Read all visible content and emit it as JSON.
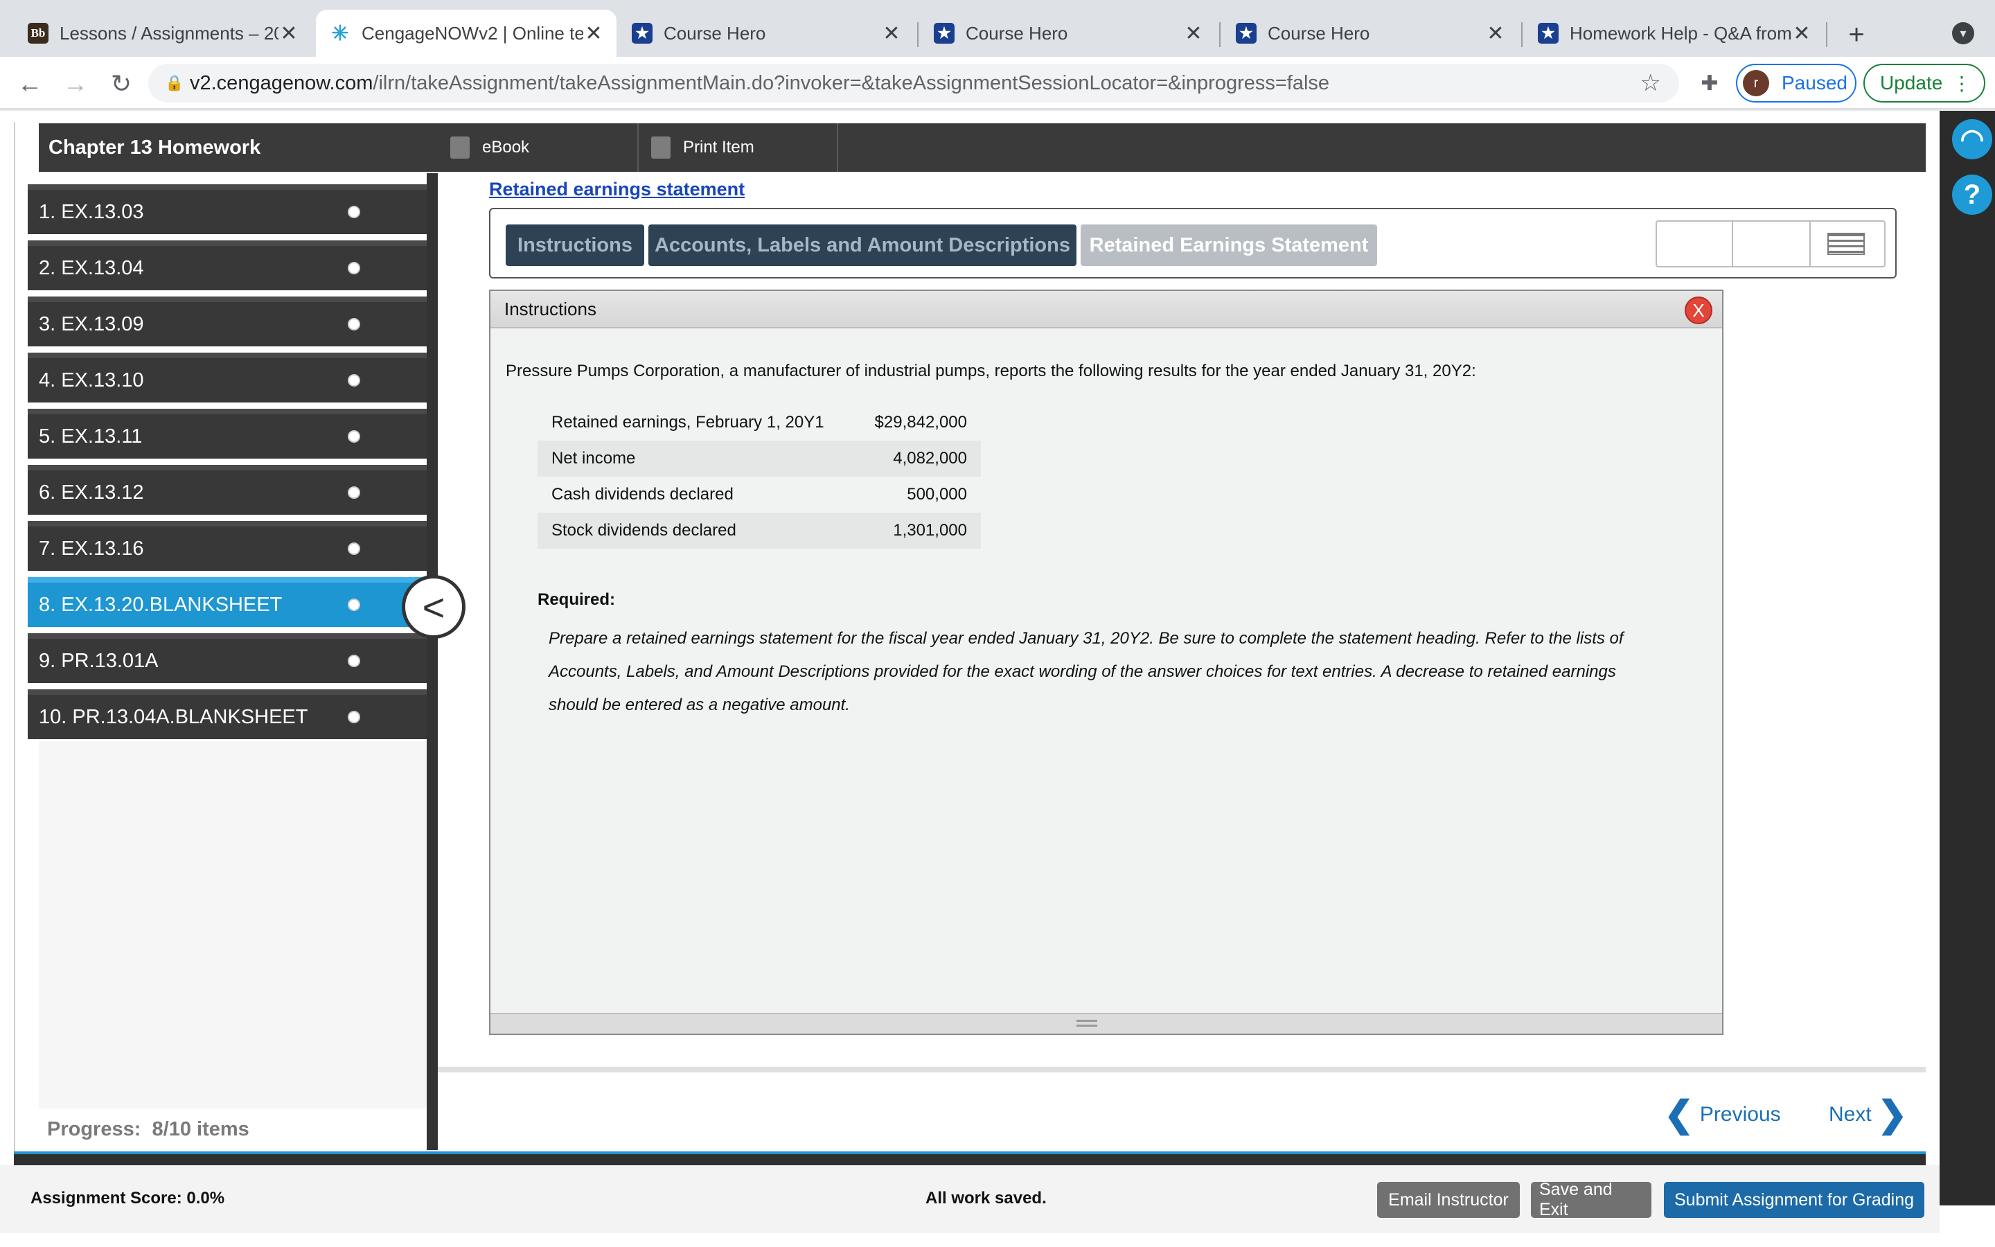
{
  "browser": {
    "tabs": [
      {
        "title": "Lessons / Assignments – 20",
        "favicon": "bb-favicon",
        "active": false
      },
      {
        "title": "CengageNOWv2 | Online te",
        "favicon": "cengage-favicon",
        "active": true
      },
      {
        "title": "Course Hero",
        "favicon": "coursehero-favicon",
        "active": false
      },
      {
        "title": "Course Hero",
        "favicon": "coursehero-favicon",
        "active": false
      },
      {
        "title": "Course Hero",
        "favicon": "coursehero-favicon",
        "active": false
      },
      {
        "title": "Homework Help - Q&A from",
        "favicon": "coursehero-favicon",
        "active": false
      }
    ],
    "url_host": "v2.cengagenow.com",
    "url_path": "/ilrn/takeAssignment/takeAssignmentMain.do?invoker=&takeAssignmentSessionLocator=&inprogress=false",
    "profile_initial": "r",
    "profile_label": "Paused",
    "update_label": "Update"
  },
  "assignment": {
    "title": "Chapter 13 Homework",
    "toolbar": {
      "ebook": "eBook",
      "print_item": "Print Item"
    },
    "questions": [
      {
        "label": "1. EX.13.03"
      },
      {
        "label": "2. EX.13.04"
      },
      {
        "label": "3. EX.13.09"
      },
      {
        "label": "4. EX.13.10"
      },
      {
        "label": "5. EX.13.11"
      },
      {
        "label": "6. EX.13.12"
      },
      {
        "label": "7. EX.13.16"
      },
      {
        "label": "8. EX.13.20.BLANKSHEET",
        "active": true
      },
      {
        "label": "9. PR.13.01A"
      },
      {
        "label": "10. PR.13.04A.BLANKSHEET"
      }
    ],
    "progress_label": "Progress:",
    "progress_value": "8/10 items",
    "progress_fraction": 0.8
  },
  "content": {
    "section_title": "Retained earnings statement",
    "subtabs": [
      "Instructions",
      "Accounts, Labels and Amount Descriptions",
      "Retained Earnings Statement"
    ],
    "selected_subtab": "Retained Earnings Statement",
    "panel_title": "Instructions",
    "close_label": "X",
    "intro": "Pressure Pumps Corporation, a manufacturer of industrial pumps, reports the following results for the year ended January 31, 20Y2:",
    "rows": [
      {
        "label": "Retained earnings, February 1, 20Y1",
        "amount": "$29,842,000"
      },
      {
        "label": "Net income",
        "amount": "4,082,000"
      },
      {
        "label": "Cash dividends declared",
        "amount": "500,000"
      },
      {
        "label": "Stock dividends declared",
        "amount": "1,301,000"
      }
    ],
    "required_label": "Required:",
    "required_text": "Prepare a retained earnings statement for the fiscal year ended January 31, 20Y2. Be sure to complete the statement heading. Refer to the lists of Accounts, Labels, and Amount Descriptions provided for the exact wording of the answer choices for text entries. A decrease to retained earnings should be entered as a negative amount."
  },
  "navigation": {
    "previous": "Previous",
    "next": "Next"
  },
  "footer": {
    "score": "Assignment Score: 0.0%",
    "status": "All work saved.",
    "email": "Email Instructor",
    "save_exit": "Save and Exit",
    "submit": "Submit Assignment for Grading"
  },
  "colors": {
    "accent": "#1d96d2",
    "link": "#1846b8",
    "submit": "#1c6aa8",
    "close": "#e2453a"
  }
}
